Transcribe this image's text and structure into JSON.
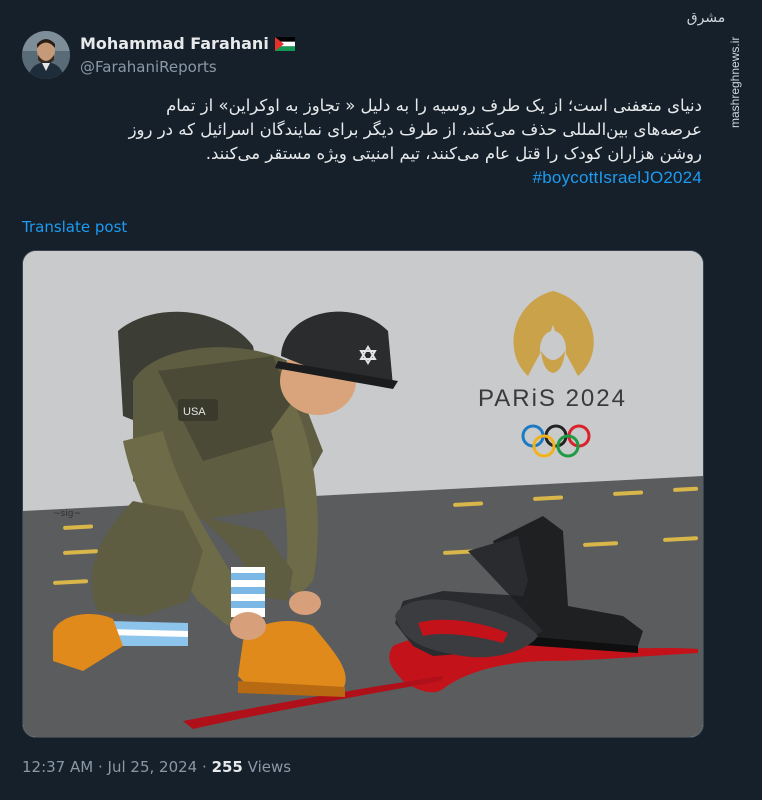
{
  "author": {
    "name": "Mohammad Farahani",
    "handle": "@FarahaniReports",
    "flag_icon": "palestine-flag-icon"
  },
  "watermark": {
    "logo_text": "مشرق",
    "site": "mashreghnews.ir"
  },
  "post": {
    "lines": [
      "دنیای متعفنی است؛ از یک طرف  روسیه را به دلیل « تجاوز به اوکراین»  از تمام",
      "عرصه‌های بین‌المللی حذف می‌کنند، از طرف دیگر برای نمایندگان اسرائیل که در روز",
      "روشن هزاران کودک را قتل عام می‌کنند، تیم امنیتی ویژه مستقر می‌کنند."
    ],
    "hashtag": "#boycottIsraelJO2024",
    "translate_label": "Translate post"
  },
  "media": {
    "description_icon": "cartoon-image",
    "logo_text": "PARiS 2024",
    "colors": {
      "gold": "#c9a24a",
      "blood": "#c4121a"
    }
  },
  "footer": {
    "time": "12:37 AM",
    "separator": "·",
    "date": "Jul 25, 2024",
    "views_count": "255",
    "views_label": "Views"
  }
}
